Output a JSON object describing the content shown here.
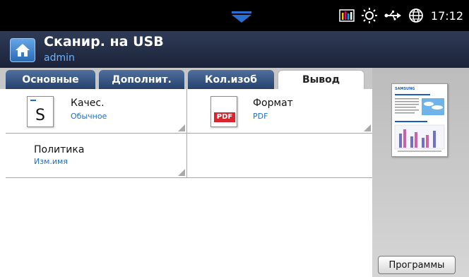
{
  "status_bar": {
    "time": "17:12",
    "icons": [
      "toner-level-icon",
      "sun-icon",
      "usb-icon",
      "globe-icon"
    ]
  },
  "header": {
    "title": "Сканир. на USB",
    "user": "admin"
  },
  "tabs": [
    {
      "label": "Основные"
    },
    {
      "label": "Дополнит."
    },
    {
      "label": "Кол.изоб"
    },
    {
      "label": "Вывод",
      "active": true
    }
  ],
  "settings": {
    "quality": {
      "label": "Качес.",
      "value": "Обычное",
      "icon_letter": "S"
    },
    "format": {
      "label": "Формат",
      "value": "PDF",
      "icon_badge": "PDF"
    },
    "policy": {
      "label": "Политика",
      "value": "Изм.имя"
    }
  },
  "preview": {
    "brand": "SAMSUNG"
  },
  "programs_button": "Программы",
  "colors": {
    "accent_blue": "#1a6fd6",
    "subtitle_blue": "#6ab4ff",
    "tab_blue": "#26426c",
    "pdf_red": "#d8262f"
  }
}
